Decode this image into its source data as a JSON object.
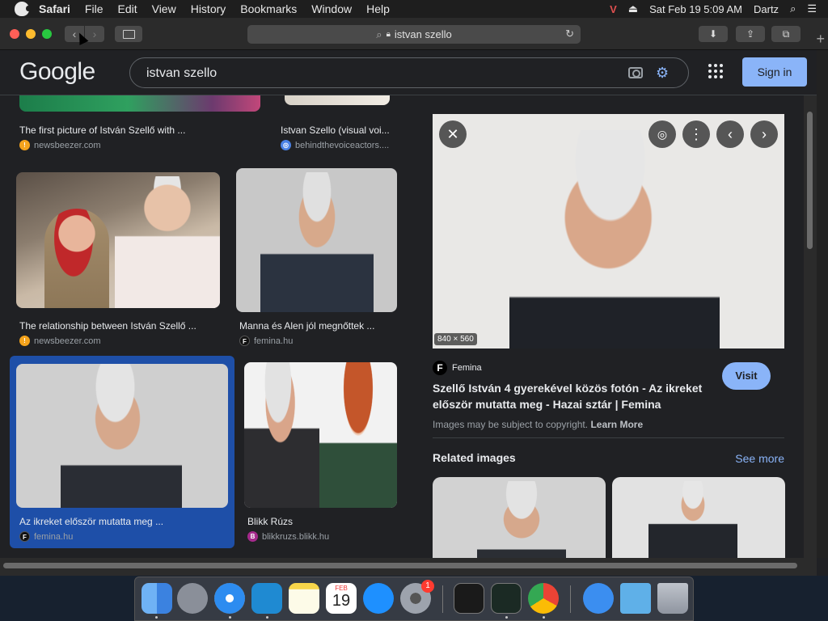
{
  "menubar": {
    "app": "Safari",
    "items": [
      "File",
      "Edit",
      "View",
      "History",
      "Bookmarks",
      "Window",
      "Help"
    ],
    "clock": "Sat Feb 19  5:09 AM",
    "user": "Dartz"
  },
  "browser": {
    "url": "istvan szello"
  },
  "google": {
    "logo": "Google",
    "query": "istvan szello",
    "signin": "Sign in"
  },
  "results": [
    {
      "title": "The first picture of István Szellő with ...",
      "source": "newsbeezer.com"
    },
    {
      "title": "Istvan Szello (visual voi...",
      "source": "behindthevoiceactors...."
    },
    {
      "title": "The relationship between István Szellő ...",
      "source": "newsbeezer.com"
    },
    {
      "title": "Manna és Alen jól megnőttek ...",
      "source": "femina.hu"
    },
    {
      "title": "Az ikreket először mutatta meg ...",
      "source": "femina.hu"
    },
    {
      "title": "Blikk Rúzs",
      "source": "blikkruzs.blikk.hu"
    }
  ],
  "detail": {
    "size": "840 × 560",
    "source": "Femina",
    "title": "Szellő István 4 gyerekével közös fotón - Az ikreket először mutatta meg - Hazai sztár | Femina",
    "visit": "Visit",
    "copyright": "Images may be subject to copyright.",
    "learn_more": "Learn More",
    "related": "Related images",
    "see_more": "See more"
  },
  "dock": {
    "calendar_month": "FEB",
    "calendar_day": "19",
    "badge": "1"
  }
}
